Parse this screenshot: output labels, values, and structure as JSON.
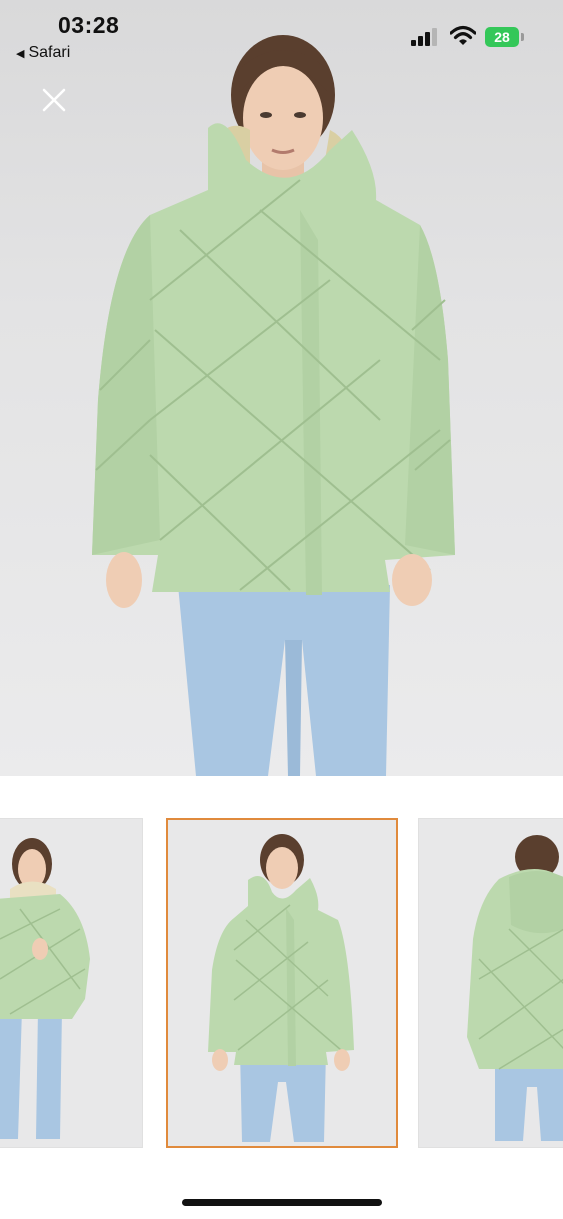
{
  "status_bar": {
    "time": "03:28",
    "back_app": "Safari",
    "battery": "28",
    "icons": [
      "cellular-signal-icon",
      "wifi-icon",
      "battery-charging-icon"
    ]
  },
  "viewer": {
    "close_icon": "close-icon",
    "main_image": "product-photo-front-mint-quilted-jacket",
    "thumbnails": [
      {
        "image": "product-photo-angle-open-hood",
        "selected": false
      },
      {
        "image": "product-photo-front",
        "selected": true
      },
      {
        "image": "product-photo-back",
        "selected": false
      }
    ]
  },
  "colors": {
    "jacket": "#bcd9ae",
    "jeans": "#a9c6e2",
    "selected_border": "#e08a3c",
    "battery": "#34c759"
  }
}
